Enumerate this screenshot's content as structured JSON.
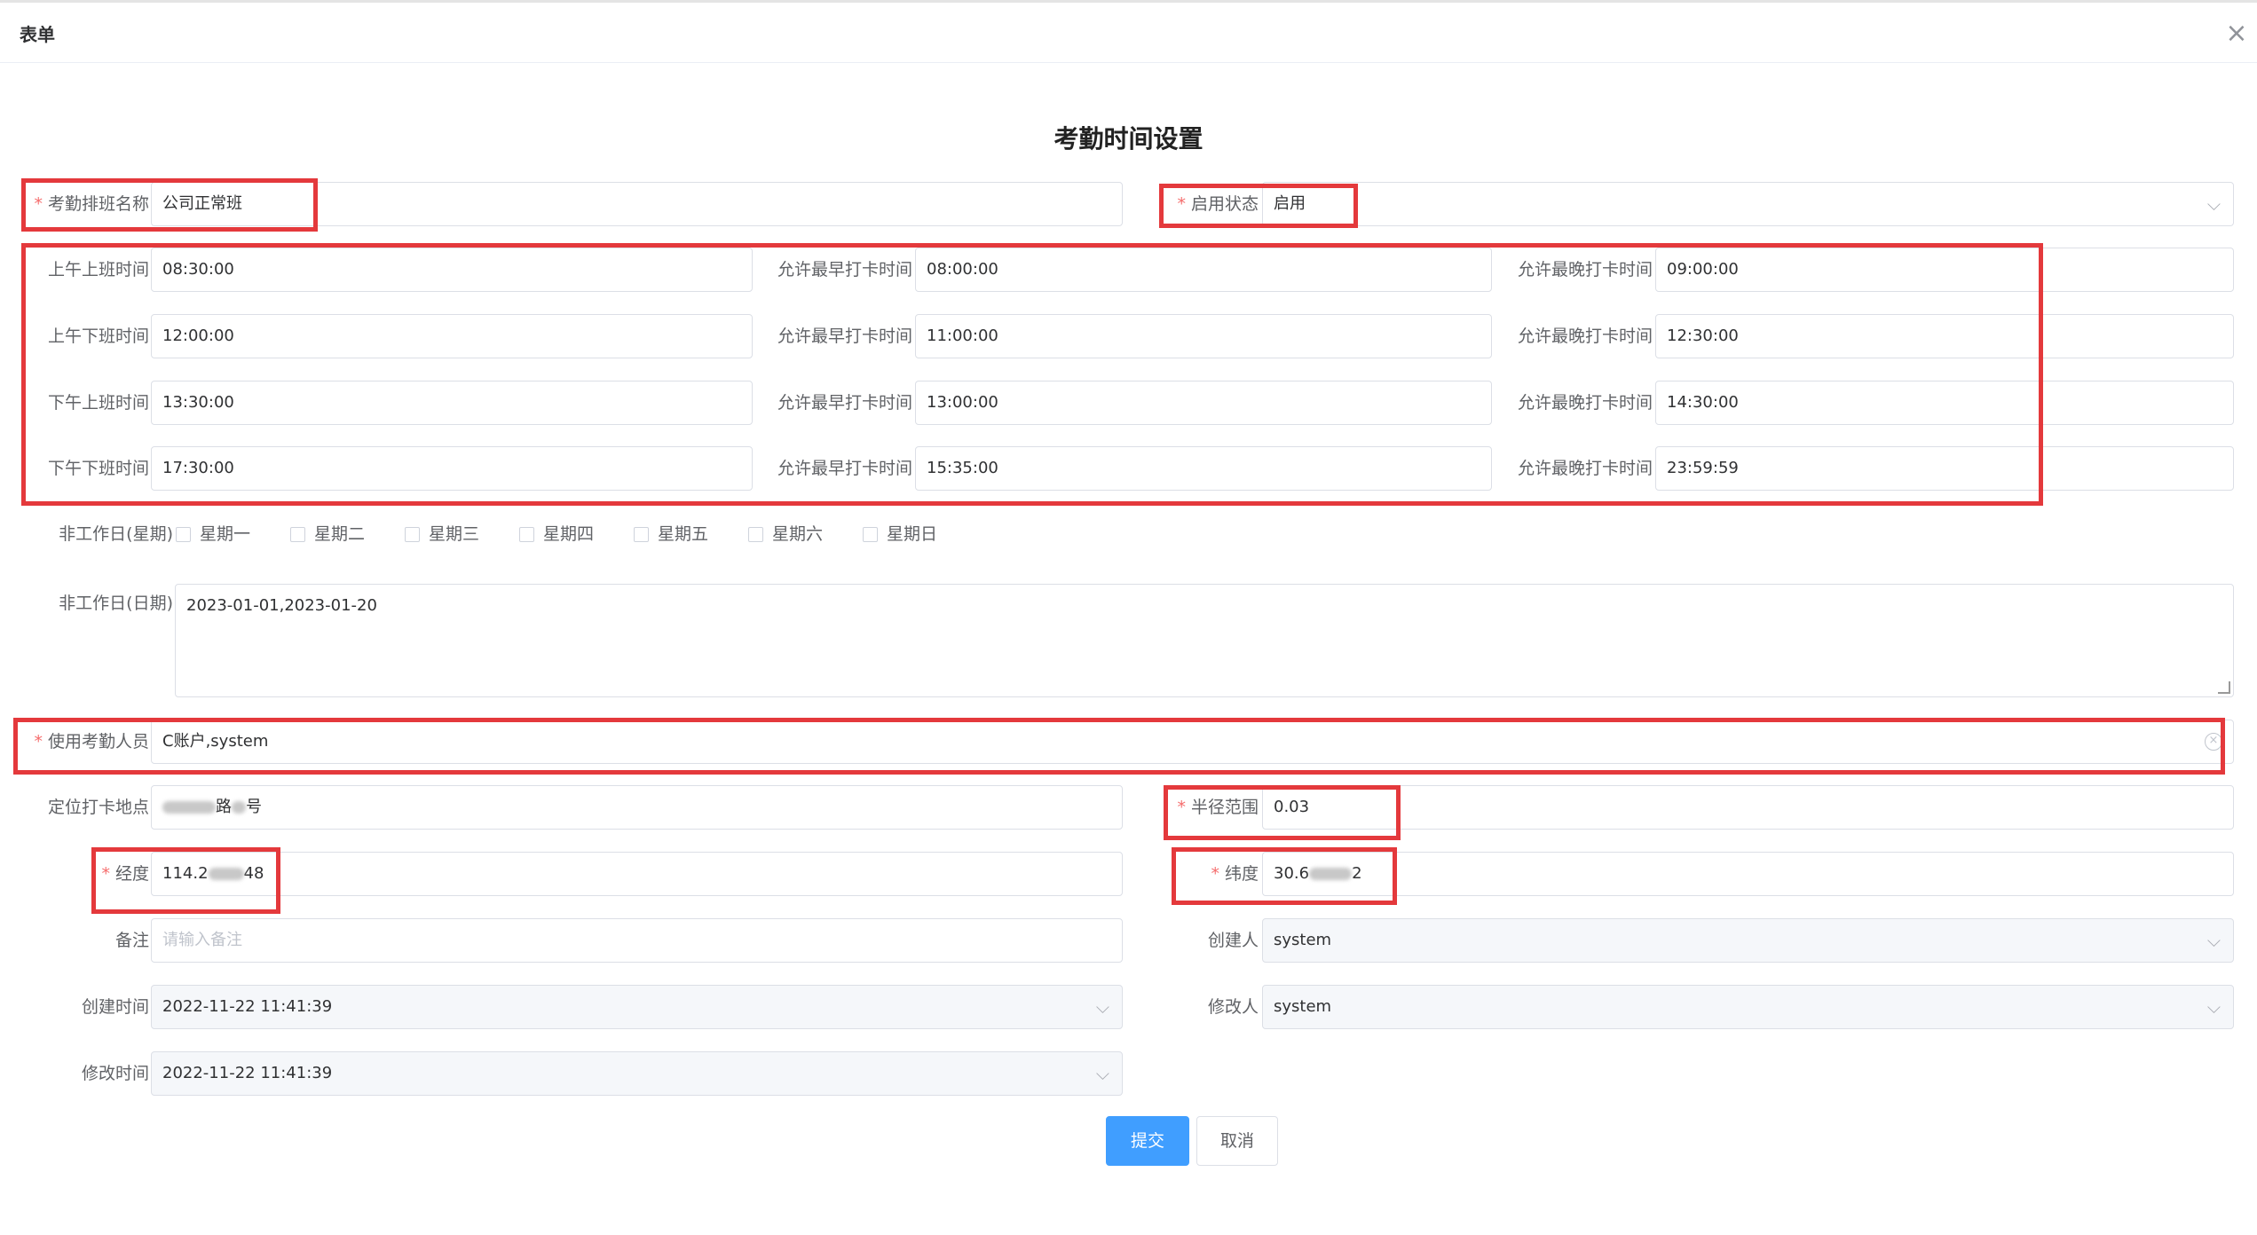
{
  "window": {
    "title": "表单"
  },
  "form": {
    "title": "考勤时间设置",
    "shift_name": {
      "label": "考勤排班名称",
      "value": "公司正常班"
    },
    "status": {
      "label": "启用状态",
      "value": "启用"
    },
    "times": [
      {
        "label": "上午上班时间",
        "value": "08:30:00",
        "earliest_label": "允许最早打卡时间",
        "earliest": "08:00:00",
        "latest_label": "允许最晚打卡时间",
        "latest": "09:00:00"
      },
      {
        "label": "上午下班时间",
        "value": "12:00:00",
        "earliest_label": "允许最早打卡时间",
        "earliest": "11:00:00",
        "latest_label": "允许最晚打卡时间",
        "latest": "12:30:00"
      },
      {
        "label": "下午上班时间",
        "value": "13:30:00",
        "earliest_label": "允许最早打卡时间",
        "earliest": "13:00:00",
        "latest_label": "允许最晚打卡时间",
        "latest": "14:30:00"
      },
      {
        "label": "下午下班时间",
        "value": "17:30:00",
        "earliest_label": "允许最早打卡时间",
        "earliest": "15:35:00",
        "latest_label": "允许最晚打卡时间",
        "latest": "23:59:59"
      }
    ],
    "weekdays": {
      "label": "非工作日(星期)",
      "options": [
        "星期一",
        "星期二",
        "星期三",
        "星期四",
        "星期五",
        "星期六",
        "星期日"
      ]
    },
    "dates": {
      "label": "非工作日(日期)",
      "value": "2023-01-01,2023-01-20"
    },
    "users": {
      "label": "使用考勤人员",
      "value": "C账户,system"
    },
    "location": {
      "label": "定位打卡地点",
      "value_visible_part": "路",
      "value_suffix": "号"
    },
    "radius": {
      "label": "半径范围",
      "value": "0.03"
    },
    "longitude": {
      "label": "经度",
      "value_prefix": "114.2",
      "value_suffix": "48"
    },
    "latitude": {
      "label": "纬度",
      "value_prefix": "30.6",
      "value_suffix": "2"
    },
    "remark": {
      "label": "备注",
      "placeholder": "请输入备注"
    },
    "creator": {
      "label": "创建人",
      "value": "system"
    },
    "created_at": {
      "label": "创建时间",
      "value": "2022-11-22 11:41:39"
    },
    "modifier": {
      "label": "修改人",
      "value": "system"
    },
    "modified_at": {
      "label": "修改时间",
      "value": "2022-11-22 11:41:39"
    }
  },
  "buttons": {
    "submit": "提交",
    "cancel": "取消"
  },
  "colors": {
    "primary": "#409eff",
    "required": "#f56c6c",
    "highlight": "#e4393c",
    "border": "#dcdfe6"
  },
  "icons": {
    "close": "close-icon",
    "dropdown": "chevron-down-icon",
    "clear": "clear-icon"
  }
}
